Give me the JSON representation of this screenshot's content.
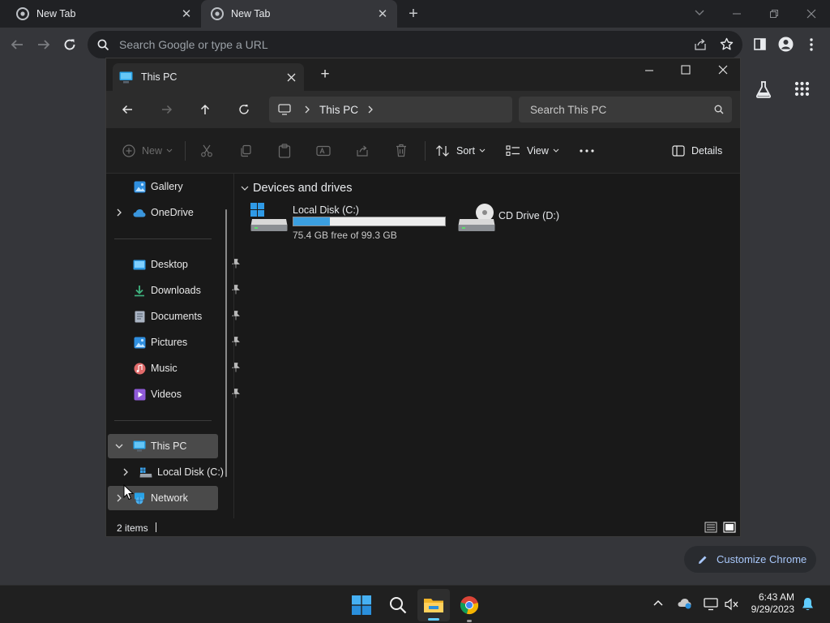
{
  "chrome": {
    "tabs": [
      {
        "title": "New Tab",
        "state": "inactive"
      },
      {
        "title": "New Tab",
        "state": "active"
      }
    ],
    "omnibox_placeholder": "Search Google or type a URL",
    "customize_label": "Customize Chrome"
  },
  "explorer": {
    "tab_title": "This PC",
    "breadcrumb": [
      "This PC"
    ],
    "search_placeholder": "Search This PC",
    "toolbar": {
      "new_label": "New",
      "sort_label": "Sort",
      "view_label": "View",
      "details_label": "Details"
    },
    "nav": {
      "top": [
        {
          "label": "Gallery",
          "icon": "gallery-icon"
        },
        {
          "label": "OneDrive",
          "icon": "cloud-icon"
        }
      ],
      "pinned": [
        {
          "label": "Desktop",
          "icon": "desktop-icon"
        },
        {
          "label": "Downloads",
          "icon": "download-icon"
        },
        {
          "label": "Documents",
          "icon": "document-icon"
        },
        {
          "label": "Pictures",
          "icon": "pictures-icon"
        },
        {
          "label": "Music",
          "icon": "music-icon"
        },
        {
          "label": "Videos",
          "icon": "video-icon"
        }
      ],
      "this_pc": "This PC",
      "local_disk": "Local Disk (C:)",
      "network": "Network"
    },
    "group_title": "Devices and drives",
    "drives": [
      {
        "name": "Local Disk (C:)",
        "free_text": "75.4 GB free of 99.3 GB",
        "used_fraction": 0.24
      },
      {
        "name": "CD Drive (D:)"
      }
    ],
    "status_count": "2 items"
  },
  "taskbar": {
    "time": "6:43 AM",
    "date": "9/29/2023"
  },
  "colors": {
    "accent": "#3b9fe0",
    "chrome_bg": "#35363a",
    "explorer_bg": "#191919"
  }
}
